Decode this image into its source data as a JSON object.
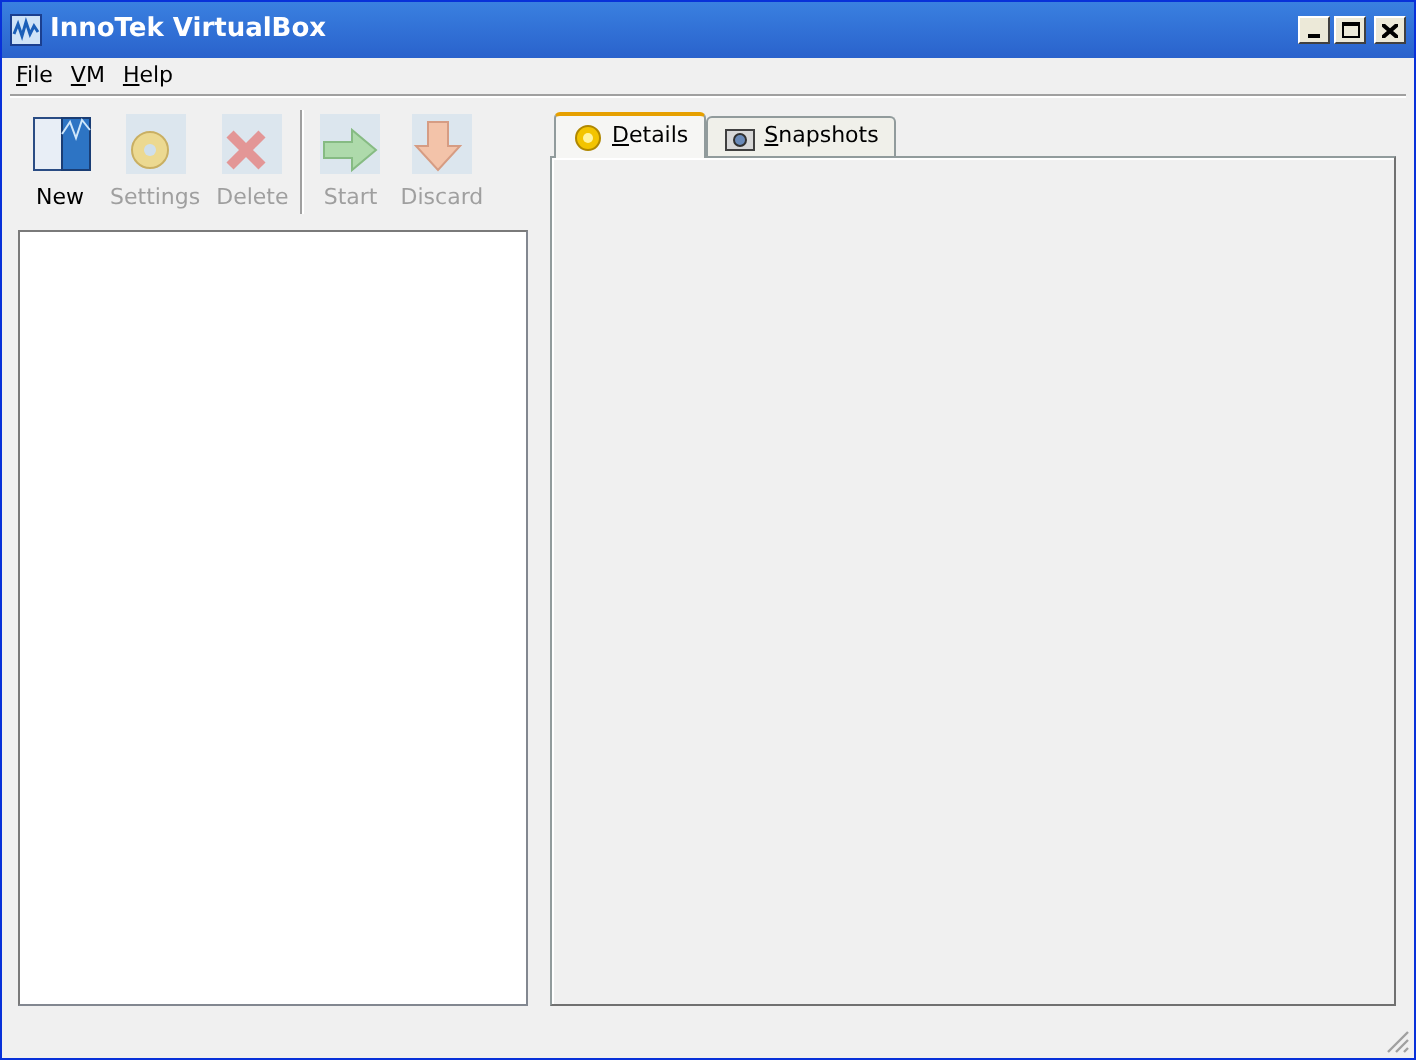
{
  "window": {
    "title": "InnoTek VirtualBox"
  },
  "menu": [
    {
      "label": "File"
    },
    {
      "label": "VM"
    },
    {
      "label": "Help"
    }
  ],
  "toolbar": [
    {
      "label": "New",
      "kind": "new",
      "disabled": false
    },
    {
      "label": "Settings",
      "kind": "settings",
      "disabled": true
    },
    {
      "label": "Delete",
      "kind": "delete",
      "disabled": true
    },
    {
      "label": "Start",
      "kind": "start",
      "disabled": true
    },
    {
      "label": "Discard",
      "kind": "discard",
      "disabled": true
    }
  ],
  "tabs": [
    {
      "label": "Details",
      "kind": "details",
      "selected": true
    },
    {
      "label": "Snapshots",
      "kind": "snapshots",
      "selected": false
    }
  ]
}
